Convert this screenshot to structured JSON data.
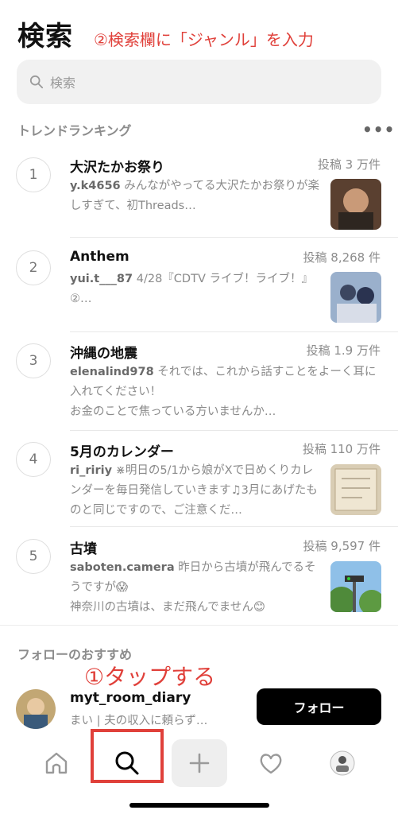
{
  "header": {
    "title": "検索"
  },
  "annotations": {
    "top": "②検索欄に「ジャンル」を入力",
    "bottom": "①タップする"
  },
  "search": {
    "placeholder": "検索",
    "icon": "search-icon"
  },
  "trending": {
    "title": "トレンドランキング",
    "more": "•••",
    "items": [
      {
        "rank": "1",
        "name": "大沢たかお祭り",
        "count": "投稿 3 万件",
        "user": "y.k4656",
        "snippet": " みんながやってる大沢たかお祭りが楽しすぎて、初Threads…",
        "extra": ""
      },
      {
        "rank": "2",
        "name": "Anthem",
        "count": "投稿 8,268 件",
        "user": "yui.t___87",
        "snippet": " 4/28『CDTV ライブ！ライブ！』 ②…",
        "extra": ""
      },
      {
        "rank": "3",
        "name": "沖縄の地震",
        "count": "投稿 1.9 万件",
        "user": "elenalind978",
        "snippet": " それでは、これから話すことをよーく耳に入れてください！",
        "extra": "お金のことで焦っている方いませんか…"
      },
      {
        "rank": "4",
        "name": "5月のカレンダー",
        "count": "投稿 110 万件",
        "user": "ri_ririy",
        "snippet": " ⋇明日の5/1から娘がXで日めくりカレンダーを毎日発信していきます♫3月にあげたものと同じですので、ご注意くだ…",
        "extra": ""
      },
      {
        "rank": "5",
        "name": "古墳",
        "count": "投稿 9,597 件",
        "user": "saboten.camera",
        "snippet": " 昨日から古墳が飛んでるそうですが😱",
        "extra": "神奈川の古墳は、まだ飛んでません😊"
      }
    ]
  },
  "suggestions": {
    "title": "フォローのおすすめ",
    "user": "myt_room_diary",
    "bio": "まい | 夫の収入に頼らず…",
    "follow_label": "フォロー"
  },
  "nav": {
    "items": [
      "home-icon",
      "search-icon",
      "plus-icon",
      "heart-icon",
      "profile-avatar"
    ]
  },
  "colors": {
    "annotation": "#e0403a",
    "button": "#000000"
  }
}
